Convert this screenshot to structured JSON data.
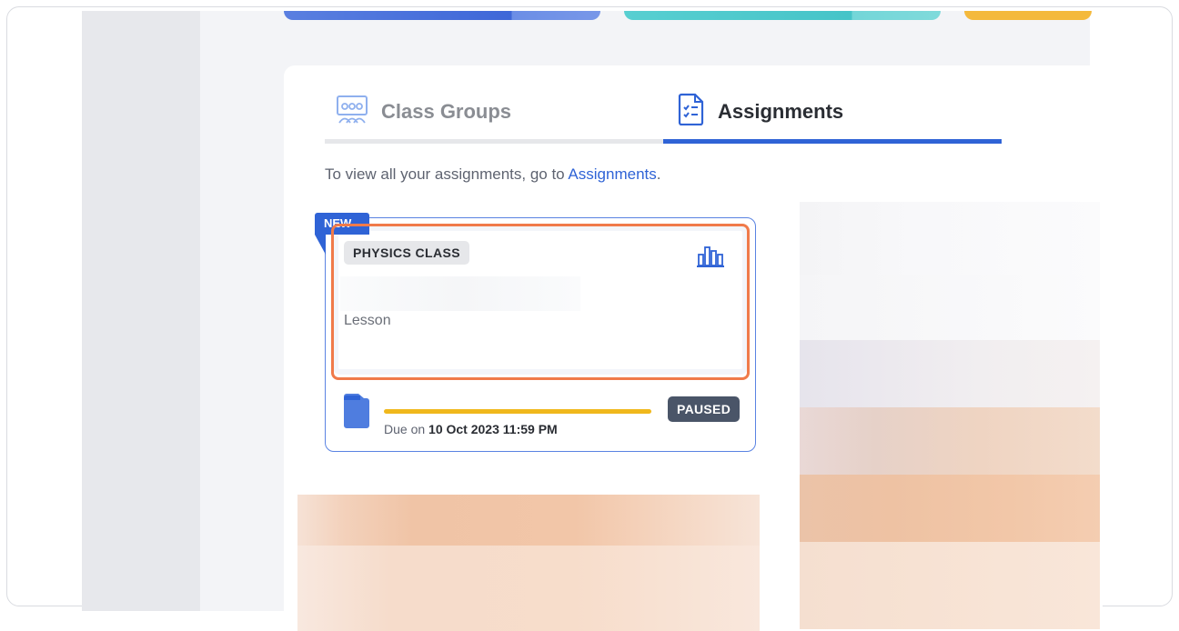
{
  "tabs": [
    {
      "label": "Class Groups",
      "icon": "class-groups-icon",
      "active": false
    },
    {
      "label": "Assignments",
      "icon": "assignment-checklist-icon",
      "active": true
    }
  ],
  "hint": {
    "prefix": "To view all your assignments, go to ",
    "link": "Assignments",
    "suffix": "."
  },
  "assignment_card": {
    "ribbon": "NEW",
    "subject": "PHYSICS CLASS",
    "type": "Lesson",
    "due_prefix": "Due on ",
    "due_date": "10 Oct 2023 11:59 PM",
    "status": "PAUSED",
    "progress_fraction": 1.0
  },
  "colors": {
    "accent": "#2f63d6",
    "highlight": "#f07a4a",
    "progress": "#f0b81c",
    "status_badge": "#4a5568"
  }
}
